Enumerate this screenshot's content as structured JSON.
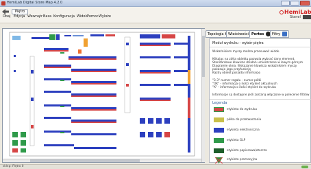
{
  "window": {
    "title": "HemiLab Digital Store Map  4.2.0",
    "app_icon": "hemilab-app-icon",
    "controls": [
      "minimize-icon",
      "maximize-icon",
      "close-icon"
    ]
  },
  "toolbar": {
    "back_icon": "back-arrow-icon",
    "button_label": "Piętro"
  },
  "menu": {
    "items": [
      "Dbaj",
      "Edycja",
      "Wewnątr",
      "Baza",
      "Konfiguracja",
      "Widok",
      "Pomoc",
      "Wyloże"
    ]
  },
  "logo": {
    "text": "HemiLab"
  },
  "status_corner": {
    "label": "Stanel"
  },
  "tabs": [
    {
      "label": "Topologia"
    },
    {
      "label": "Właściwości",
      "icon": "blue-circle-icon"
    },
    {
      "label": "Portes",
      "icon": "close-circle-icon"
    },
    {
      "label": "Filtry",
      "icon": "filter-icon"
    }
  ],
  "properties": {
    "heading": "Moduł wydruku - wybór piętra",
    "lines_a": [
      "Wskaźnikiem myszy można przesuwać widok."
    ],
    "lines_b": [
      "Klikając na zółta obiektu pozwala wybrać dany element.",
      "Standardowe klawisze działań umieszczone w lewym górnym",
      "Diagramie okna. Wskazanie klawisza wskaźnikiem myszy",
      "pokazuje jego przyfunkcję",
      "Kazdy obiekt posiada informację"
    ],
    "lines_c": [
      "\"3-3\" numer regału - numer półki",
      "\"OK\" - informacja o ilości etykiet aktualnych",
      "\"X\" - informacja o ilości etykiet do wydruku"
    ],
    "lines_d": [
      "Informacje są dostępne jeśli zostaną włączone w polecenie filtrów"
    ]
  },
  "legend": {
    "title": "Legenda",
    "items": [
      {
        "label": "etykieta do wydruku",
        "color": "#d64545"
      },
      {
        "label": "półka do przetwarzania",
        "color": "#c9c04a"
      },
      {
        "label": "etykieta elektroniczna",
        "color": "#2c3fbf"
      },
      {
        "label": "etykieta GLP",
        "color": "#2f9a4a"
      },
      {
        "label": "etykieta papierowa/etorcza",
        "color": "#1e5e2a"
      },
      {
        "label": "etykieta promocyjna",
        "color": "#3a8a3a"
      }
    ]
  },
  "status_bar": {
    "text": "sklep: Piętro 0"
  },
  "colors": {
    "accent_blue": "#3a6fc4",
    "logo_red": "#d02020"
  }
}
